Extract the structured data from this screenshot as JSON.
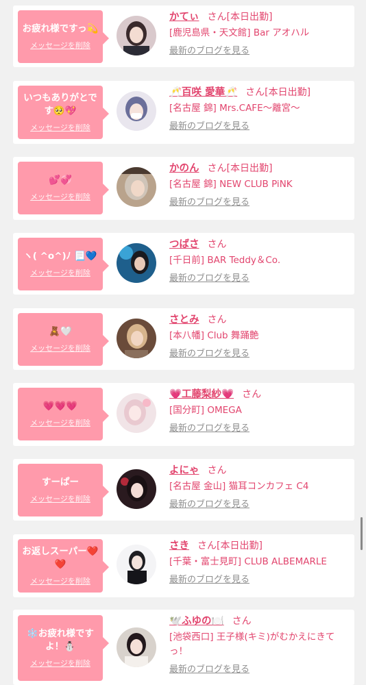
{
  "colors": {
    "bubble": "#ff9aab",
    "accent": "#e2456e",
    "link_gray": "#8e8e8e",
    "background": "#f1f1f1"
  },
  "cards": [
    {
      "message": "お疲れ様ですっ💫",
      "delete_label": "メッセージを削除",
      "name": "かてぃ",
      "honorific": "さん",
      "status": "[本日出勤]",
      "shop": "[鹿児島県・天文館] Bar アオハル",
      "blog_label": "最新のブログを見る"
    },
    {
      "message": "いつもありがとです🥺💖",
      "delete_label": "メッセージを削除",
      "name": "🥂百咲 愛華🥂",
      "honorific": "さん",
      "status": "[本日出勤]",
      "shop": "[名古屋 錦] Mrs.CAFE〜離宮〜",
      "blog_label": "最新のブログを見る"
    },
    {
      "message": "💕💞",
      "delete_label": "メッセージを削除",
      "name": "かのん",
      "honorific": "さん",
      "status": "[本日出勤]",
      "shop": "[名古屋 錦] NEW CLUB PiNK",
      "blog_label": "最新のブログを見る"
    },
    {
      "message": "ヽ( ^o^)ﾉ 📃💙",
      "delete_label": "メッセージを削除",
      "name": "つばさ",
      "honorific": "さん",
      "status": "",
      "shop": "[千日前] BAR Teddy＆Co.",
      "blog_label": "最新のブログを見る"
    },
    {
      "message": "🧸🤍",
      "delete_label": "メッセージを削除",
      "name": "さとみ",
      "honorific": "さん",
      "status": "",
      "shop": "[本八幡] Club 舞踊艶",
      "blog_label": "最新のブログを見る"
    },
    {
      "message": "💗💗💗",
      "delete_label": "メッセージを削除",
      "name": "💗工藤梨紗💗",
      "honorific": "さん",
      "status": "",
      "shop": "[国分町] OMEGA",
      "blog_label": "最新のブログを見る"
    },
    {
      "message": "すーぱー",
      "delete_label": "メッセージを削除",
      "name": "よにゃ",
      "honorific": "さん",
      "status": "",
      "shop": "[名古屋 金山] 猫耳コンカフェ C4",
      "blog_label": "最新のブログを見る"
    },
    {
      "message": "お返しスーパー❤️❤️",
      "delete_label": "メッセージを削除",
      "name": "さき",
      "honorific": "さん",
      "status": "[本日出勤]",
      "shop": "[千葉・富士見町] CLUB ALBEMARLE",
      "blog_label": "最新のブログを見る"
    },
    {
      "message": "❄️お疲れ様ですよ！⛄",
      "delete_label": "メッセージを削除",
      "name": "🕊️ふゆの🍽️",
      "honorific": "さん",
      "status": "",
      "shop": "[池袋西口] 王子様(キミ)がむかえにきてっ！",
      "blog_label": "最新のブログを見る"
    }
  ]
}
